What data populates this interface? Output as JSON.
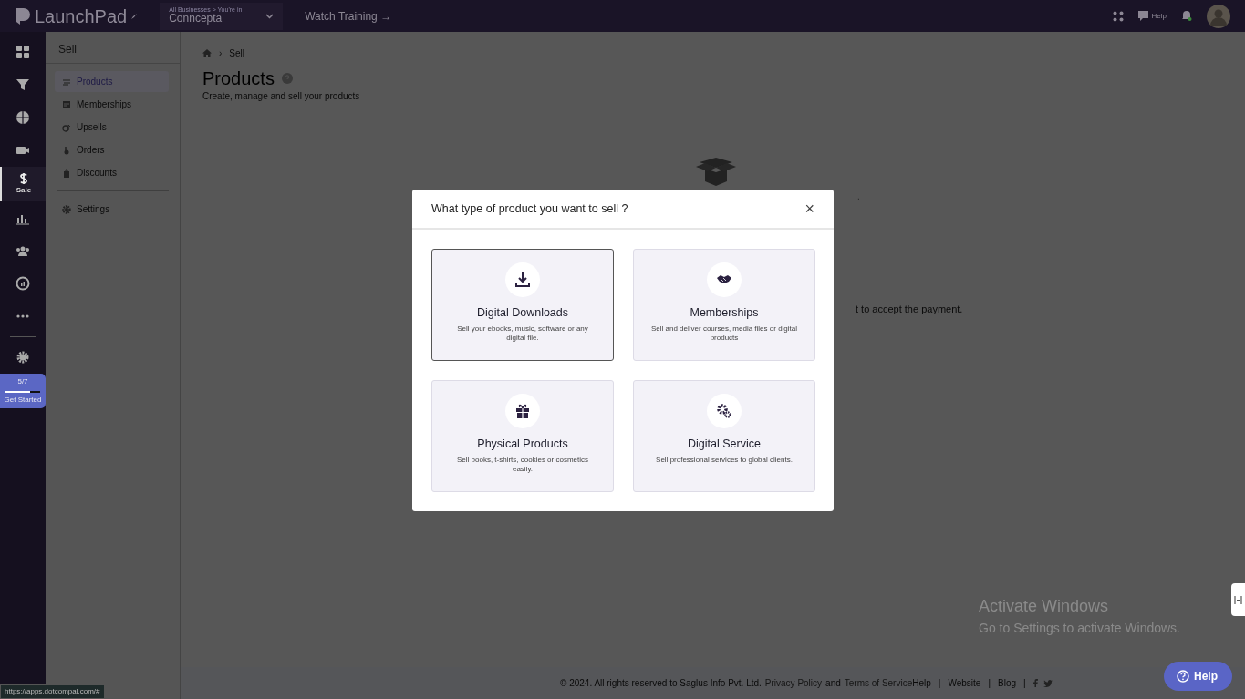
{
  "topbar": {
    "logo": "LaunchPad",
    "business_caption": "All Businesses > You're in",
    "business": "Conncepta",
    "watch_training": "Watch Training →",
    "help": "Help"
  },
  "rail": [
    {
      "selected": false
    },
    {
      "selected": false
    },
    {
      "selected": false
    },
    {
      "selected": false
    },
    {
      "label": "Sale",
      "selected": true
    },
    {
      "selected": false
    },
    {
      "selected": false
    },
    {
      "selected": false
    },
    {
      "selected": false
    }
  ],
  "get_started": {
    "progress": "5/7",
    "level": 0.72,
    "label": "Get Started"
  },
  "subnav": {
    "title": "Sell",
    "items": [
      {
        "label": "Products",
        "selected": true
      },
      {
        "label": "Memberships",
        "selected": false
      },
      {
        "label": "Upsells",
        "selected": false
      },
      {
        "label": "Orders",
        "selected": false
      },
      {
        "label": "Discounts",
        "selected": false
      }
    ],
    "settings": "Settings"
  },
  "breadcrumb": {
    "separator": "›",
    "items": [
      "Sell"
    ]
  },
  "page": {
    "title": "Products",
    "subtitle": "Create, manage and sell your products"
  },
  "empty_state": {
    "line_1": ".",
    "line_2": "t to accept the payment."
  },
  "modal": {
    "title": "What type of product you want to sell ?",
    "close": "×",
    "options": [
      {
        "title": "Digital Downloads",
        "description": "Sell your ebooks, music, software or any digital file.",
        "selected": true
      },
      {
        "title": "Memberships",
        "description": "Sell and deliver courses, media files or digital products",
        "selected": false
      },
      {
        "title": "Physical Products",
        "description": "Sell books, t-shirts, cookies or cosmetics easily.",
        "selected": false
      },
      {
        "title": "Digital Service",
        "description": "Sell professional services to global clients.",
        "selected": false
      }
    ]
  },
  "footer": {
    "copyright": "©  2024. All rights reserved to Saglus Info Pvt. Ltd.",
    "privacy": "Privacy Policy",
    "and": "and",
    "terms": "Terms of Service",
    "links": [
      "Help",
      "Website",
      "Blog"
    ],
    "separators": [
      "|",
      "|",
      "|"
    ]
  },
  "help_button": "Help",
  "os_notice": {
    "title": "Activate Windows",
    "subtitle": "Go to Settings to activate Windows."
  },
  "status_url": "https://apps.dotcompal.com/#"
}
